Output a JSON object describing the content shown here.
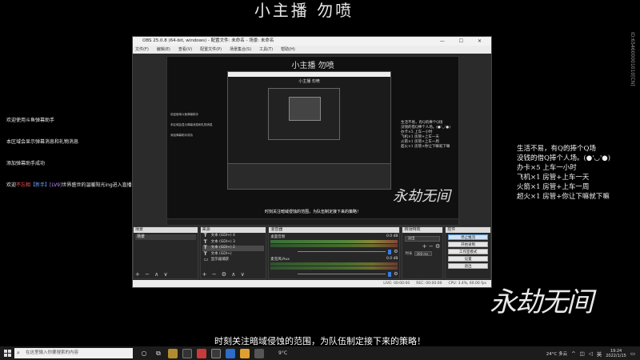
{
  "stream": {
    "title": "小主播 勿喷",
    "subtitle": "时刻关注暗域侵蚀的范围，为队伍制定接下来的策略！",
    "side_id": "ID:654600001010[CN]",
    "watermark": "永劫无间"
  },
  "chat": [
    {
      "text": "欢迎使用斗鱼弹幕助手"
    },
    {
      "text": "本区域会显示弹幕消息和礼物消息"
    },
    {
      "text": "添加弹幕助手成功"
    },
    {
      "parts": [
        "欢迎",
        "不忘相",
        "【新手】",
        "[LV9]",
        "世界盛世的温暖阳光ing进入直播间"
      ]
    }
  ],
  "rules": [
    "生活不易，有Q的捧个Q场",
    "没钱的借Q捧个人场。(●'◡'●)",
    "办卡×5  上车一小时",
    "飞机×1  房管+上车一天",
    "火箭×1  房管+上车一周",
    "超火×1  房管+你让下嘛就下嘛"
  ],
  "obs": {
    "window_title": "OBS 25.0.8 (64-bit, windows) - 配置文件: 未命名 - 场景: 未命名",
    "window_controls": "— ☐ ✕",
    "menus": [
      "文件(F)",
      "编辑(E)",
      "查看(V)",
      "配置文件(P)",
      "场景集合(S)",
      "工具(T)",
      "帮助(H)"
    ],
    "preview": {
      "title": "小主播 勿喷",
      "subtitle": "时刻关注暗域侵蚀的范围，为队伍制定接下来的策略！",
      "logo": "永劫无间"
    },
    "docks": {
      "scenes": {
        "header": "场景",
        "items": [
          "场景"
        ],
        "footer": "+ − ∧ ∨"
      },
      "sources": {
        "header": "来源",
        "items": [
          {
            "icon": "T",
            "label": "文本 (GDI+) 4"
          },
          {
            "icon": "T",
            "label": "文本 (GDI+) 3"
          },
          {
            "icon": "T",
            "label": "文本 (GDI+) 2"
          },
          {
            "icon": "T",
            "label": "文本 (GDI+)"
          },
          {
            "icon": "▭",
            "label": "显示器捕获"
          }
        ],
        "footer": "+ − ⚙ ∧ ∨"
      },
      "mixer": {
        "header": "混音器",
        "tracks": [
          {
            "name": "桌面音频",
            "db": "0.0 dB"
          },
          {
            "name": "麦克风/Aux",
            "db": "0.0 dB"
          }
        ]
      },
      "transitions": {
        "header": "转场特效",
        "selected": "淡出",
        "duration_label": "时长",
        "duration_value": "300 ms"
      },
      "controls": {
        "header": "控件",
        "buttons": [
          "停止推流",
          "开始录制",
          "工作室模式",
          "设置",
          "退出"
        ]
      }
    },
    "status": {
      "live": "LIVE: 00:00:00",
      "rec": "REC: 00:00:00",
      "cpu": "CPU: 3.4%, 60.00 fps"
    }
  },
  "taskbar": {
    "search_placeholder": "在这里输入你要搜索的内容",
    "weather_inline": "9°C",
    "tray_weather": "24°C 多云",
    "lang": "英",
    "time": "19:24",
    "date": "2022/1/15"
  }
}
